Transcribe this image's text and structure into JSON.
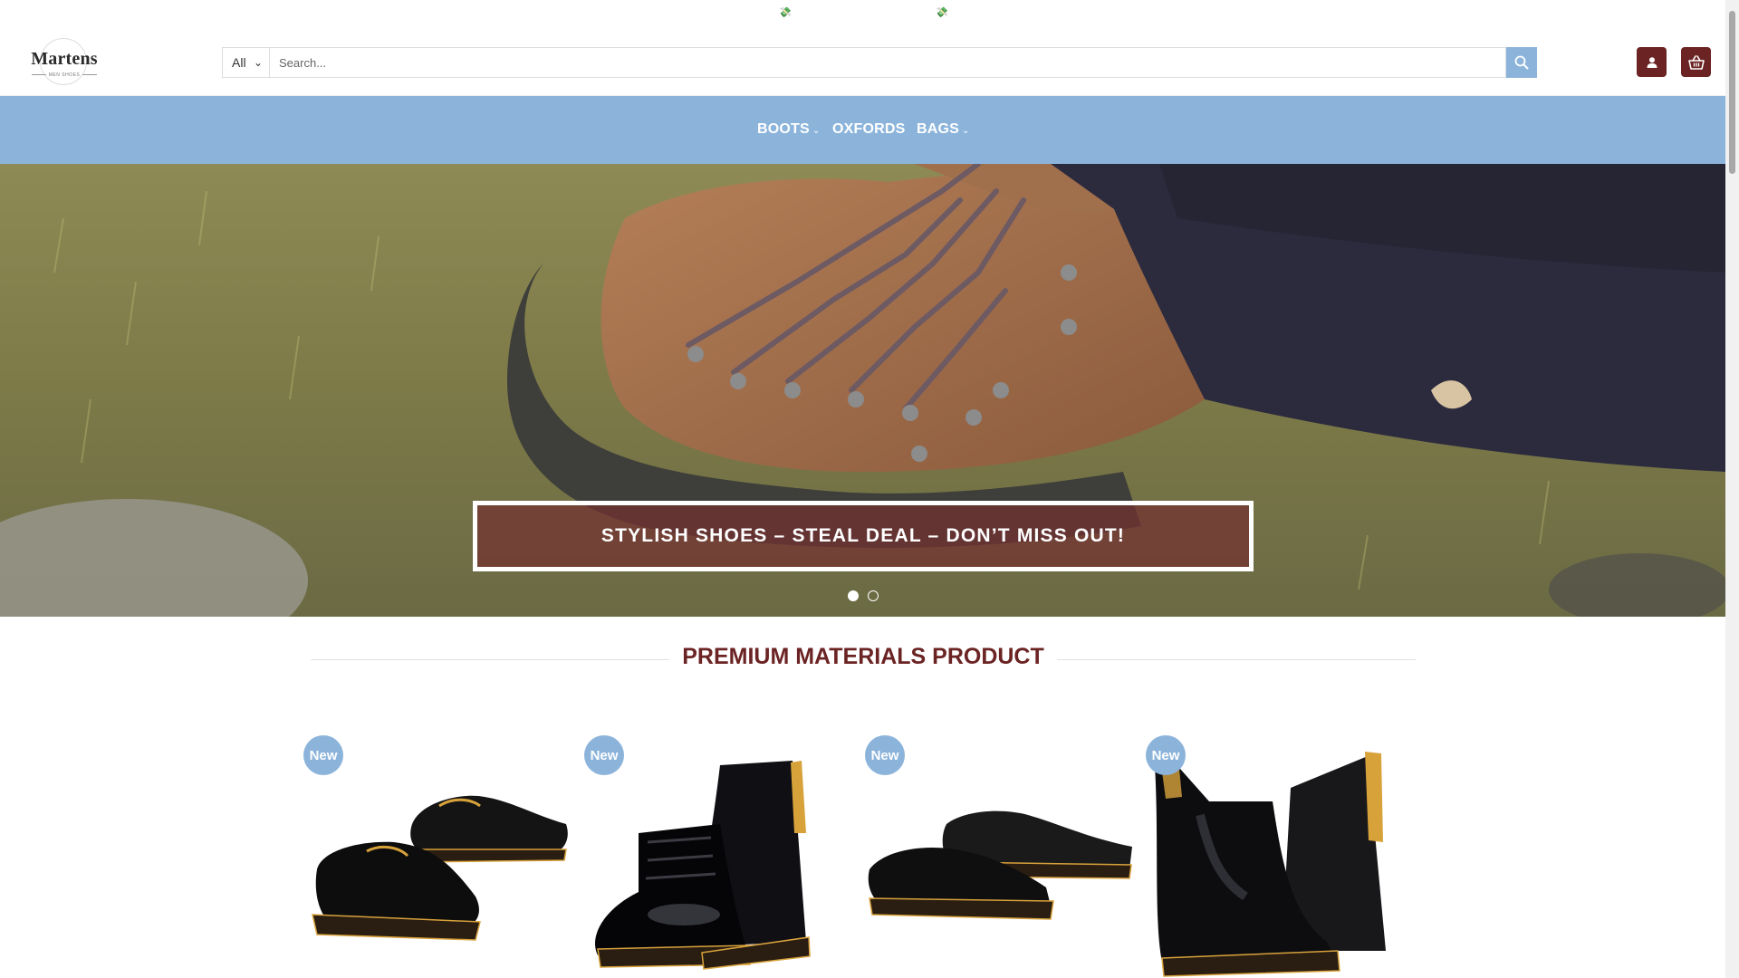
{
  "brand": {
    "name": "Martens",
    "tagline": "MEN SHOES"
  },
  "search": {
    "category_selected": "All",
    "placeholder": "Search..."
  },
  "nav": {
    "items": [
      {
        "label": "BOOTS",
        "has_dropdown": true
      },
      {
        "label": "OXFORDS",
        "has_dropdown": false
      },
      {
        "label": "BAGS",
        "has_dropdown": true
      }
    ]
  },
  "hero": {
    "banner_text": "STYLISH SHOES – STEAL DEAL – DON’T MISS OUT!",
    "slides_total": 2,
    "active_slide": 1
  },
  "section": {
    "title": "PREMIUM MATERIALS PRODUCT"
  },
  "products": [
    {
      "badge": "New"
    },
    {
      "badge": "New"
    },
    {
      "badge": "New"
    },
    {
      "badge": "New"
    }
  ],
  "colors": {
    "accent_blue": "#8cb4db",
    "brand_maroon": "#6b2323",
    "banner_fill": "#733030"
  },
  "icons": {
    "topbar": "money-icon",
    "search_button": "search-icon",
    "account": "user-icon",
    "cart": "basket-icon",
    "dropdown": "chevron-down-icon"
  }
}
